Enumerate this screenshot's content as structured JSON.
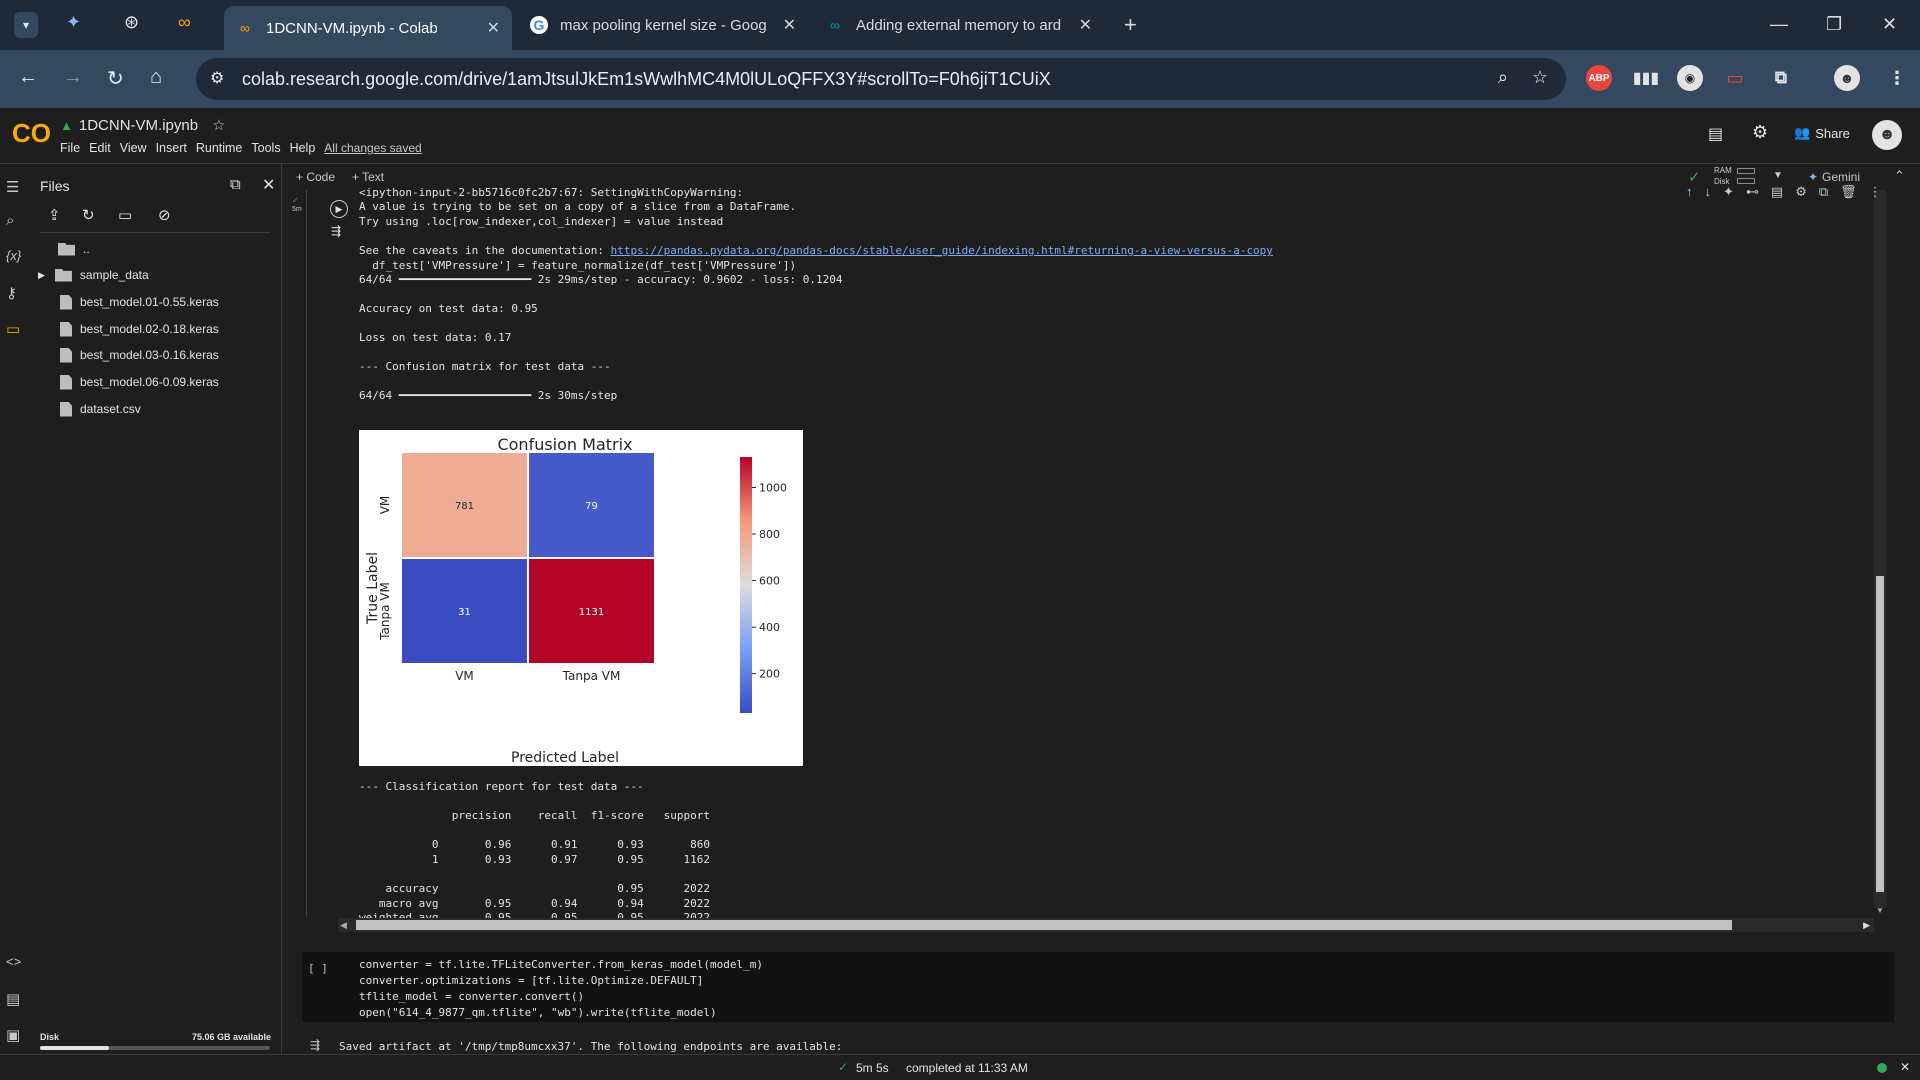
{
  "browser": {
    "tabs": [
      {
        "label": "1DCNN-VM.ipynb - Colab"
      },
      {
        "label": "max pooling kernel size - Goog"
      },
      {
        "label": "Adding external memory to ard"
      }
    ],
    "url": "colab.research.google.com/drive/1amJtsulJkEm1sWwlhMC4M0lULoQFFX3Y#scrollTo=F0h6jiT1CUiX",
    "ext_abp": "ABP"
  },
  "colab": {
    "notebook_title": "1DCNN-VM.ipynb",
    "menu": [
      "File",
      "Edit",
      "View",
      "Insert",
      "Runtime",
      "Tools",
      "Help"
    ],
    "save_status": "All changes saved",
    "share_label": "Share",
    "add_code": "+ Code",
    "add_text": "+ Text",
    "ram_label": "RAM",
    "disk_label": "Disk",
    "gemini_label": "Gemini"
  },
  "files_panel": {
    "title": "Files",
    "items": [
      {
        "name": "..",
        "kind": "folder"
      },
      {
        "name": "sample_data",
        "kind": "folder"
      },
      {
        "name": "best_model.01-0.55.keras",
        "kind": "file"
      },
      {
        "name": "best_model.02-0.18.keras",
        "kind": "file"
      },
      {
        "name": "best_model.03-0.16.keras",
        "kind": "file"
      },
      {
        "name": "best_model.06-0.09.keras",
        "kind": "file"
      },
      {
        "name": "dataset.csv",
        "kind": "file"
      }
    ],
    "disk_label": "Disk",
    "disk_available": "75.06 GB available",
    "disk_used_fraction": 0.3
  },
  "output": {
    "cell_time": "5m",
    "lines_top": [
      "<ipython-input-2-bb5716c0fc2b7:67: SettingWithCopyWarning:",
      "A value is trying to be set on a copy of a slice from a DataFrame.",
      "Try using .loc[row_indexer,col_indexer] = value instead"
    ],
    "caveat_prefix": "See the caveats in the documentation: ",
    "caveat_link": "https://pandas.pydata.org/pandas-docs/stable/user_guide/indexing.html#returning-a-view-versus-a-copy",
    "line_normalize": "  df_test['VMPressure'] = feature_normalize(df_test['VMPressure'])",
    "progress1": "64/64 ━━━━━━━━━━━━━━━━━━━━ 2s 29ms/step - accuracy: 0.9602 - loss: 0.1204",
    "accuracy_line": "Accuracy on test data: 0.95",
    "loss_line": "Loss on test data: 0.17",
    "cm_header": "--- Confusion matrix for test data ---",
    "progress2": "64/64 ━━━━━━━━━━━━━━━━━━━━ 2s 30ms/step",
    "report_header": "--- Classification report for test data ---",
    "report_table": "              precision    recall  f1-score   support\n\n           0       0.96      0.91      0.93       860\n           1       0.93      0.97      0.95      1162\n\n    accuracy                           0.95      2022\n   macro avg       0.95      0.94      0.94      2022\nweighted avg       0.95      0.95      0.95      2022"
  },
  "chart_data": {
    "type": "heatmap",
    "title": "Confusion Matrix",
    "xlabel": "Predicted Label",
    "ylabel": "True Label",
    "x_categories": [
      "VM",
      "Tanpa VM"
    ],
    "y_categories": [
      "VM",
      "Tanpa VM"
    ],
    "values": [
      [
        781,
        79
      ],
      [
        31,
        1131
      ]
    ],
    "colorbar_ticks": [
      200,
      400,
      600,
      800,
      1000
    ],
    "colormap": "coolwarm",
    "vmin": 31,
    "vmax": 1131
  },
  "code_cell": {
    "marker": "[ ]",
    "lines": [
      "converter = tf.lite.TFLiteConverter.from_keras_model(model_m)",
      "converter.optimizations = [tf.lite.Optimize.DEFAULT]",
      "tflite_model = converter.convert()",
      "open(\"614_4_9877_qm.tflite\", \"wb\").write(tflite_model)"
    ],
    "output": "Saved artifact at '/tmp/tmp8umcxx37'. The following endpoints are available:"
  },
  "status": {
    "elapsed": "5m 5s",
    "completed": "completed at 11:33 AM"
  },
  "colors": {
    "accent": "#f9ab00",
    "link": "#7cacf8",
    "ok": "#34a853",
    "abp": "#e8453c"
  }
}
